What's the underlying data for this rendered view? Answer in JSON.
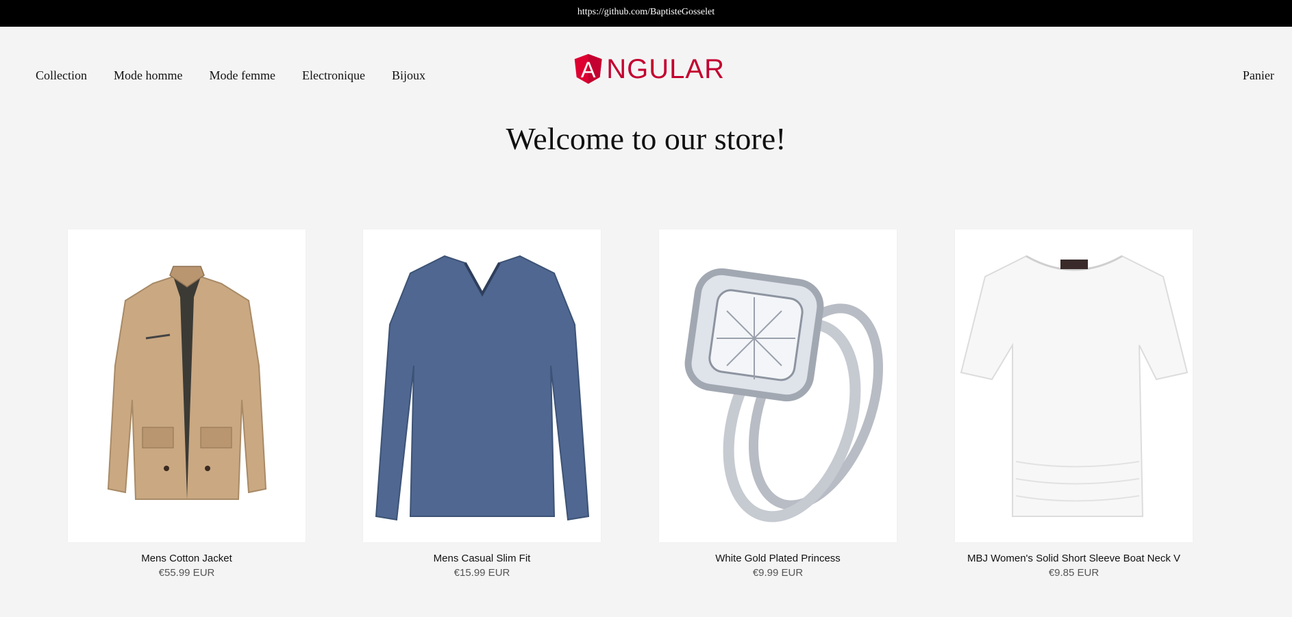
{
  "topbar": {
    "url_text": "https://github.com/BaptisteGosselet"
  },
  "nav": {
    "items": [
      {
        "label": "Collection"
      },
      {
        "label": "Mode homme"
      },
      {
        "label": "Mode femme"
      },
      {
        "label": "Electronique"
      },
      {
        "label": "Bijoux"
      }
    ],
    "cart_label": "Panier"
  },
  "logo": {
    "letter": "A",
    "text": "NGULAR",
    "icon": "angular-logo-icon",
    "color": "#c3002f"
  },
  "hero": {
    "title": "Welcome to our store!"
  },
  "products": [
    {
      "name": "Mens Cotton Jacket",
      "price": "€55.99 EUR",
      "image_icon": "jacket-image"
    },
    {
      "name": "Mens Casual Slim Fit",
      "price": "€15.99 EUR",
      "image_icon": "tshirt-image"
    },
    {
      "name": "White Gold Plated Princess",
      "price": "€9.99 EUR",
      "image_icon": "ring-image"
    },
    {
      "name": "MBJ Women's Solid Short Sleeve Boat Neck V",
      "price": "€9.85 EUR",
      "image_icon": "womens-top-image"
    }
  ]
}
